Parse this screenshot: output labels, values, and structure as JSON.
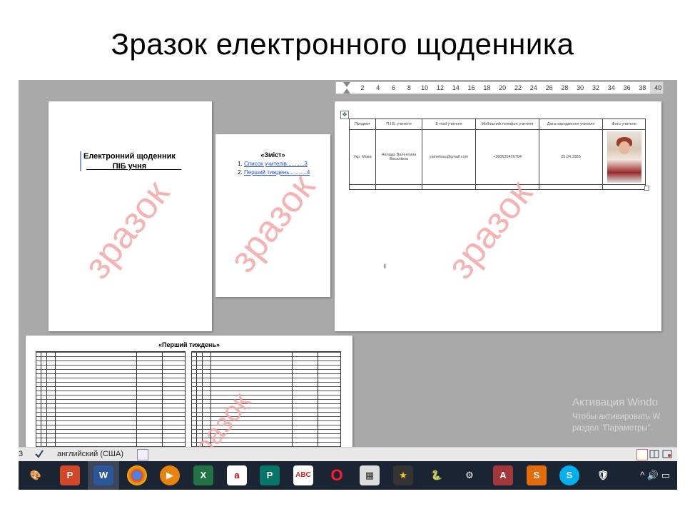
{
  "slide": {
    "title": "Зразок електронного щоденника"
  },
  "ruler": {
    "ticks": [
      "2",
      "4",
      "6",
      "8",
      "10",
      "12",
      "14",
      "16",
      "18",
      "20",
      "22",
      "24",
      "26",
      "28",
      "30",
      "32",
      "34",
      "36",
      "38",
      "40"
    ]
  },
  "watermark": "зразок",
  "page1": {
    "line1": "Електронний щоденник",
    "line2": "______ПІБ учня________"
  },
  "page2": {
    "title": "«Зміст»",
    "items": [
      "Список учителів...........3",
      "Перший тиждень...........4"
    ]
  },
  "page3": {
    "headers": [
      "Предмет",
      "П.І.Б. учителя",
      "E-mail учителя",
      "Мобільний телефон учителя",
      "Дата народження учителя",
      "Фото учителя"
    ],
    "row": [
      "Укр. Мова",
      "Нелада Валентина Василівна",
      "yamelnau@gmail.com",
      "+380635426704",
      "25.04.1985",
      ""
    ]
  },
  "page4": {
    "title": "«Перший тиждень»"
  },
  "activation": {
    "title": "Активация Windo",
    "line1": "Чтобы активировать W",
    "line2": "раздел \"Параметры\"."
  },
  "statusbar": {
    "page": "3",
    "language": "английский (США)"
  },
  "taskbar": {
    "icons": [
      "paint-icon",
      "powerpoint-icon",
      "word-icon",
      "chrome-icon",
      "media-player-icon",
      "excel-icon",
      "translate-icon",
      "publisher-icon",
      "abc-icon",
      "opera-icon",
      "calculator-icon",
      "movie-maker-icon",
      "python-icon",
      "settings-icon",
      "access-icon",
      "smart-icon",
      "skype-icon",
      "shield-icon"
    ]
  },
  "colors": {
    "watermark": "#f4a6a6",
    "link": "#2850d8",
    "taskbar": "#1b2433",
    "workspace": "#a9a9a9"
  }
}
